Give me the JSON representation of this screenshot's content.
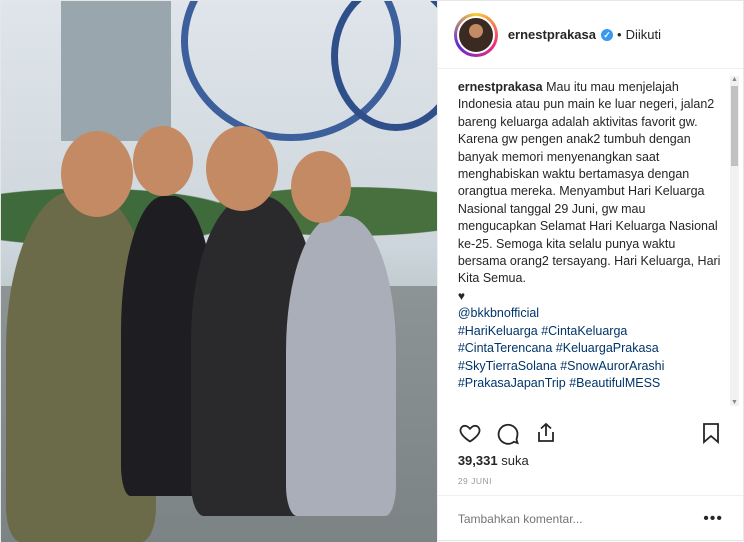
{
  "header": {
    "username": "ernestprakasa",
    "verified_mark": "✓",
    "separator": "•",
    "follow_status": "Diikuti"
  },
  "caption": {
    "username": "ernestprakasa",
    "text": "Mau itu mau menjelajah Indonesia atau pun main ke luar negeri, jalan2 bareng keluarga adalah aktivitas favorit gw. Karena gw pengen anak2 tumbuh dengan banyak memori menyenangkan saat menghabiskan waktu bertamasya dengan orangtua mereka. Menyambut Hari Keluarga Nasional tanggal 29 Juni, gw mau mengucapkan Selamat Hari Keluarga Nasional ke-25. Semoga kita selalu punya waktu bersama orang2 tersayang. Hari Keluarga, Hari Kita Semua.",
    "heart": "♥",
    "tags": [
      "@bkkbnofficial",
      "#HariKeluarga #CintaKeluarga",
      "#CintaTerencana #KeluargaPrakasa",
      "#SkyTierraSolana #SnowAurorArashi",
      "#PrakasaJapanTrip #BeautifulMESS"
    ]
  },
  "stats": {
    "likes_count": "39,331",
    "likes_label": "suka",
    "date": "29 JUNI"
  },
  "comment": {
    "placeholder": "Tambahkan komentar...",
    "more_label": "•••"
  },
  "icons": [
    "heart-icon",
    "comment-icon",
    "share-icon",
    "bookmark-icon",
    "verified-icon"
  ],
  "colors": {
    "link": "#003569",
    "verified": "#3897f0",
    "text": "#262626",
    "muted": "#999999"
  }
}
